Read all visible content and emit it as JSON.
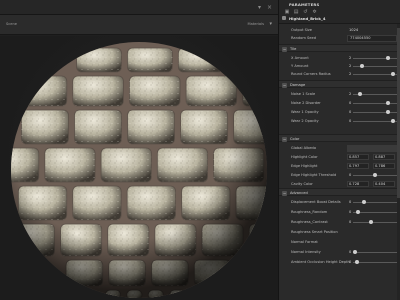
{
  "viewport": {
    "mode_label": "Scene",
    "materials_label": "Materials"
  },
  "panel": {
    "title": "PARAMETERS",
    "asset_name": "Highland_Brick_4",
    "output_size": {
      "label": "Output Size",
      "value": "1024"
    },
    "random_seed": {
      "label": "Random Seed",
      "value": "774004550"
    },
    "sections": {
      "tile": "Tile",
      "damage": "Damage",
      "color": "Color",
      "advanced": "Advanced"
    },
    "tile_params": [
      {
        "label": "X Amount",
        "value": "2",
        "level": 0.8
      },
      {
        "label": "Y Amount",
        "value": "2",
        "level": 0.2
      },
      {
        "label": "Round Corners Radius",
        "value": "2",
        "level": 0.92
      }
    ],
    "damage_params": [
      {
        "label": "Noise 1 Scale",
        "value": "2",
        "level": 0.15
      },
      {
        "label": "Noise 2 Disorder",
        "value": "0",
        "level": 0.8
      },
      {
        "label": "Wear 1 Opacity",
        "value": "0",
        "level": 0.8
      },
      {
        "label": "Wear 2 Opacity",
        "value": "0",
        "level": 0.92
      }
    ],
    "color": {
      "global_albedo": {
        "label": "Global Albedo",
        "color": "#3a3a3a"
      },
      "highlight_color": {
        "label": "Highlight Color",
        "v1": "0.857",
        "v2": "0.887"
      },
      "edge_highlight": {
        "label": "Edge Highlight",
        "v1": "0.797",
        "v2": "0.786"
      },
      "edge_highlight_threshold": {
        "label": "Edge Highlight Threshold",
        "value": "0",
        "level": 0.5
      },
      "cavity_color": {
        "label": "Cavity Color",
        "v1": "0.728",
        "v2": "0.404"
      }
    },
    "advanced_params": [
      {
        "label": "Displacement Boost Details",
        "value": "0",
        "level": 0.25,
        "slider": true
      },
      {
        "label": "Roughness_Random",
        "value": "0",
        "level": 0.12,
        "slider": true
      },
      {
        "label": "Roughness_Contrast",
        "value": "0",
        "level": 0.42,
        "slider": true
      },
      {
        "label": "Roughness Smart Position",
        "value": "",
        "level": 0,
        "slider": false
      },
      {
        "label": "Normal Format",
        "value": "",
        "level": 0,
        "slider": false
      },
      {
        "label": "Normal Intensity",
        "value": "0",
        "level": 0.05,
        "slider": true
      },
      {
        "label": "Ambient Occlusion Height Depth",
        "value": "0",
        "level": 0.08,
        "slider": true
      }
    ]
  },
  "colors": {
    "mortar": "#6e5f55",
    "stone_light": "#d9d4c4",
    "stone_mid": "#a9a491",
    "stone_dark": "#4c463e"
  }
}
